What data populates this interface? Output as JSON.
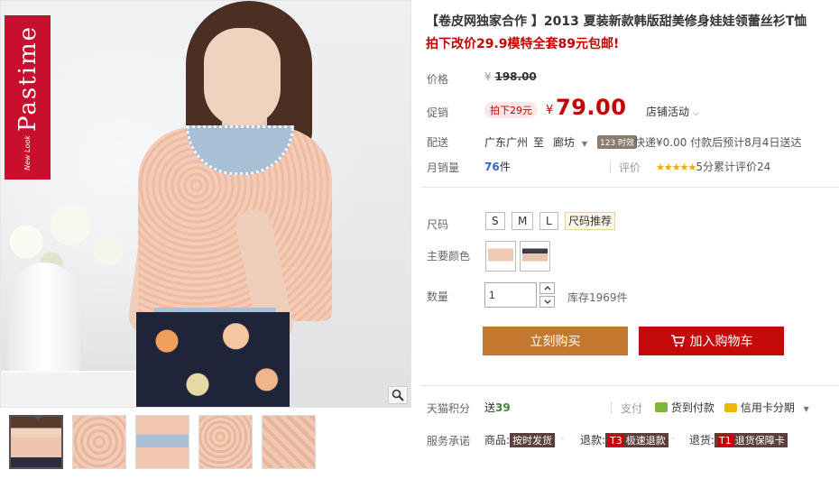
{
  "gallery": {
    "brand_text": "Pastime",
    "brand_sub": "New Look",
    "zoom_icon": "magnifier-icon"
  },
  "product": {
    "title": "【卷皮网独家合作 】2013 夏装新款韩版甜美修身娃娃领蕾丝衫T恤",
    "promo": "拍下改价29.9模特全套89元包邮!",
    "price_label": "价格",
    "original_price": "198.00",
    "currency": "¥",
    "promo_label": "促销",
    "promo_tag": "拍下29元",
    "promo_price": "79.00",
    "store_activity": "店铺活动",
    "ship_label": "配送",
    "ship_from": "广东广州",
    "ship_to_word": "至",
    "ship_to": "廊坊",
    "express_badge": "123 时效",
    "express_text": "快递¥0.00 付款后预计8月4日送达",
    "sales_label": "月销量",
    "sales_count": "76",
    "sales_unit": "件",
    "rating_label": "评价",
    "rating_stars": "★★★★★",
    "rating_text": "5分累计评价24"
  },
  "options": {
    "size_label": "尺码",
    "sizes": [
      "S",
      "M",
      "L"
    ],
    "size_recommend": "尺码推荐",
    "color_label": "主要颜色",
    "qty_label": "数量",
    "qty_value": "1",
    "stock_text": "库存1969件"
  },
  "actions": {
    "buy_now": "立刻购买",
    "add_cart": "加入购物车"
  },
  "extras": {
    "points_label": "天猫积分",
    "points_prefix": "送",
    "points_value": "39",
    "pay_label": "支付",
    "pay_cod": "货到付款",
    "pay_credit": "信用卡分期",
    "service_label": "服务承诺",
    "svc_goods_prefix": "商品:",
    "svc_goods": "按时发货",
    "svc_refund_prefix": "退款:",
    "svc_refund_code": "T3",
    "svc_refund": "极速退款",
    "svc_return_prefix": "退货:",
    "svc_return_code": "T1",
    "svc_return": "退货保障卡"
  },
  "colors": {
    "accent_red": "#c40000",
    "buy_orange": "#c4782e",
    "cart_red": "#c40a0a"
  }
}
